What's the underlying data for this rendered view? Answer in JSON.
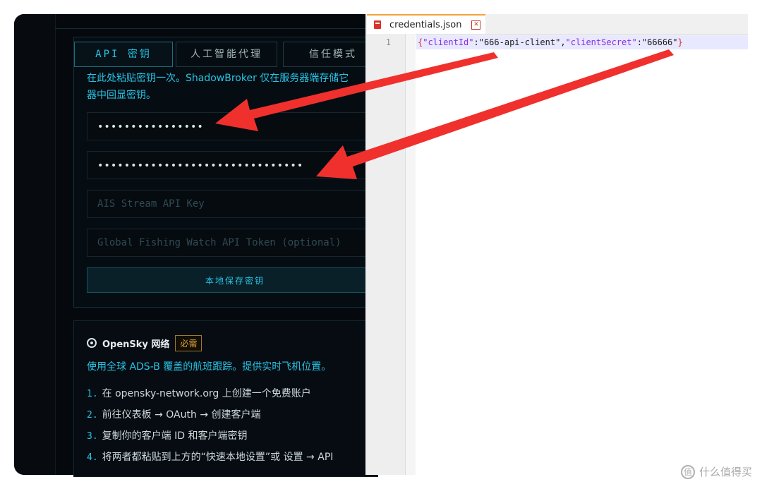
{
  "app": {
    "tabs": [
      {
        "label": "API 密钥",
        "active": true
      },
      {
        "label": "人工智能代理",
        "active": false
      },
      {
        "label": "信任模式",
        "active": false
      }
    ],
    "description": "在此处粘贴密钥一次。ShadowBroker 仅在服务器端存储它\n器中回显密钥。",
    "fields": [
      {
        "masked": "••••••••••••••••",
        "placeholder": ""
      },
      {
        "masked": "•••••••••••••••••••••••••••••••",
        "placeholder": ""
      },
      {
        "masked": "",
        "placeholder": "AIS Stream API Key"
      },
      {
        "masked": "",
        "placeholder": "Global Fishing Watch API Token (optional)"
      }
    ],
    "save_button": "本地保存密钥",
    "opensky": {
      "name": "OpenSky 网络",
      "badge": "必需",
      "description": "使用全球 ADS-B 覆盖的航班跟踪。提供实时飞机位置。",
      "steps": [
        {
          "num": "1.",
          "text": "在 opensky-network.org 上创建一个免费账户"
        },
        {
          "num": "2.",
          "text": "前往仪表板 → OAuth → 创建客户端"
        },
        {
          "num": "3.",
          "text": "复制你的客户端 ID 和客户端密钥"
        },
        {
          "num": "4.",
          "text": "将两者都粘贴到上方的“快速本地设置”或 设置 → API"
        }
      ]
    }
  },
  "editor": {
    "tab_name": "credentials.json",
    "line_number": "1",
    "code": {
      "open": "{",
      "key1": "\"clientId\"",
      "val1": "\"666-api-client\"",
      "key2": "\"clientSecret\"",
      "val2": "\"66666\"",
      "close": "}"
    }
  },
  "colors": {
    "accent": "#27c3e6",
    "arrow": "#f0302d",
    "badge": "#e0a83a"
  },
  "watermark": {
    "icon": "值",
    "text": "什么值得买"
  }
}
